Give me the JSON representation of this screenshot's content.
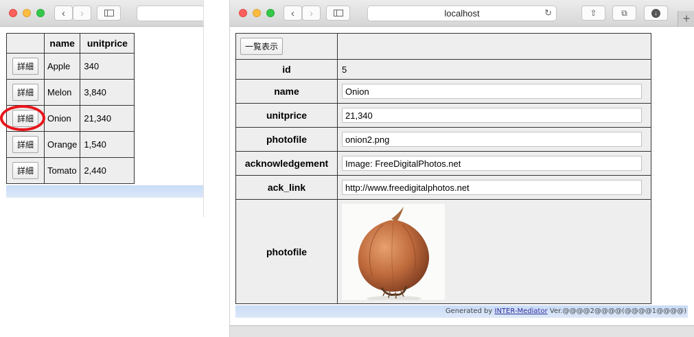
{
  "left_window": {
    "list": {
      "headers": [
        "",
        "name",
        "unitprice"
      ],
      "rows": [
        {
          "button": "詳細",
          "name": "Apple",
          "unitprice": "340"
        },
        {
          "button": "詳細",
          "name": "Melon",
          "unitprice": "3,840"
        },
        {
          "button": "詳細",
          "name": "Onion",
          "unitprice": "21,340"
        },
        {
          "button": "詳細",
          "name": "Orange",
          "unitprice": "1,540"
        },
        {
          "button": "詳細",
          "name": "Tomato",
          "unitprice": "2,440"
        }
      ]
    },
    "highlight_color": "#e8151b"
  },
  "right_window": {
    "url": "localhost",
    "list_button": "一覧表示",
    "fields": {
      "id_label": "id",
      "id_value": "5",
      "name_label": "name",
      "name_value": "Onion",
      "unitprice_label": "unitprice",
      "unitprice_value": "21,340",
      "photofile_label": "photofile",
      "photofile_value": "onion2.png",
      "acknowledgement_label": "acknowledgement",
      "acknowledgement_value": "Image: FreeDigitalPhotos.net",
      "ack_link_label": "ack_link",
      "ack_link_value": "http://www.freedigitalphotos.net",
      "photo_label": "photofile"
    },
    "footer": {
      "prefix": "Generated by ",
      "link": "INTER-Mediator",
      "suffix": " Ver.@@@@2@@@@(@@@@1@@@@)"
    }
  }
}
